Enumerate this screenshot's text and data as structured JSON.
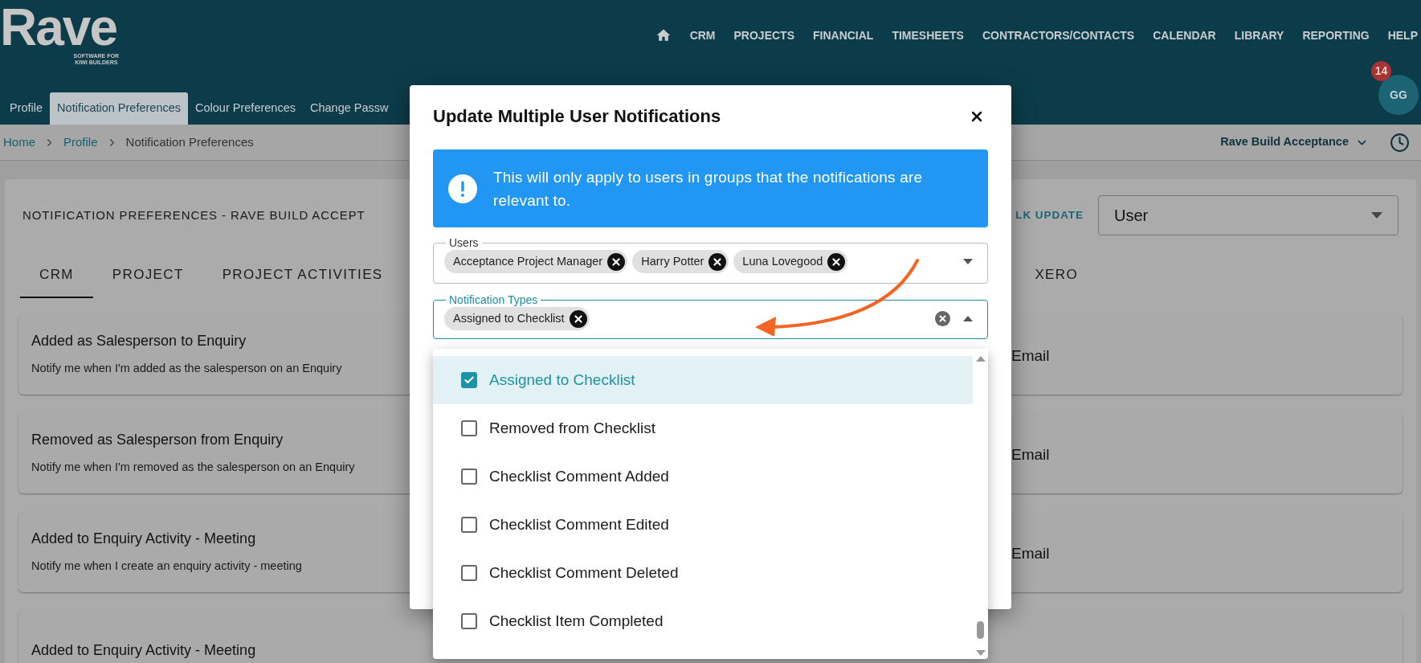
{
  "header": {
    "logo": "Rave",
    "tagline": [
      "SOFTWARE FOR",
      "KIWI BUILDERS"
    ],
    "nav": [
      "CRM",
      "PROJECTS",
      "FINANCIAL",
      "TIMESHEETS",
      "CONTRACTORS/CONTACTS",
      "CALENDAR",
      "LIBRARY",
      "REPORTING",
      "HELP"
    ],
    "avatar": {
      "initials": "GG",
      "badge": "14"
    }
  },
  "profile_tabs": [
    {
      "label": "Profile",
      "selected": false
    },
    {
      "label": "Notification Preferences",
      "selected": true
    },
    {
      "label": "Colour Preferences",
      "selected": false
    },
    {
      "label": "Change Passw",
      "selected": false
    }
  ],
  "breadcrumb": [
    {
      "label": "Home",
      "kind": "link"
    },
    {
      "label": "Profile",
      "kind": "link"
    },
    {
      "label": "Notification Preferences",
      "kind": "current"
    }
  ],
  "company_selector": "Rave Build Acceptance",
  "page": {
    "title": "NOTIFICATION PREFERENCES - RAVE BUILD ACCEPT",
    "bulk_update": "LK UPDATE",
    "scope_select": "User",
    "tabs": [
      {
        "label": "CRM",
        "selected": true
      },
      {
        "label": "PROJECT",
        "selected": false
      },
      {
        "label": "PROJECT ACTIVITIES",
        "selected": false
      },
      {
        "label": "XERO",
        "selected": false
      }
    ],
    "notifications": [
      {
        "title": "Added as Salesperson to Enquiry",
        "description": "Notify me when I'm added as the salesperson on an Enquiry",
        "channel": "Email"
      },
      {
        "title": "Removed as Salesperson from Enquiry",
        "description": "Notify me when I'm removed as the salesperson on an Enquiry",
        "channel": "Email"
      },
      {
        "title": "Added to Enquiry Activity - Meeting",
        "description": "Notify me when I create an enquiry activity - meeting",
        "channel": "Email"
      },
      {
        "title": "Added to Enquiry Activity - Meeting"
      }
    ]
  },
  "dialog": {
    "title": "Update Multiple User Notifications",
    "info": "This will only apply to users in groups that the notifications are relevant to.",
    "users": {
      "label": "Users",
      "chips": [
        "Acceptance Project Manager",
        "Harry Potter",
        "Luna Lovegood"
      ]
    },
    "notification_types": {
      "label": "Notification Types",
      "chips": [
        "Assigned to Checklist"
      ],
      "expanded": true
    },
    "options": [
      {
        "label": "Assigned to Checklist",
        "checked": true
      },
      {
        "label": "Removed from Checklist",
        "checked": false
      },
      {
        "label": "Checklist Comment Added",
        "checked": false
      },
      {
        "label": "Checklist Comment Edited",
        "checked": false
      },
      {
        "label": "Checklist Comment Deleted",
        "checked": false
      },
      {
        "label": "Checklist Item Completed",
        "checked": false
      }
    ]
  }
}
